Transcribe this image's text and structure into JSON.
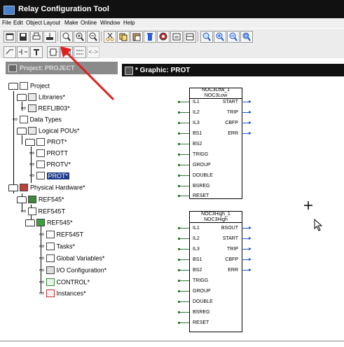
{
  "window": {
    "title": "Relay Configuration Tool"
  },
  "menu": [
    "File",
    "Edit",
    "Object",
    "Layout",
    "Make",
    "Online",
    "Window",
    "Help"
  ],
  "project_panel": {
    "title": "Project: PROJECT"
  },
  "tree": [
    {
      "label": "Project"
    },
    {
      "label": "Libraries*"
    },
    {
      "label": "REFLIB03*"
    },
    {
      "label": "Data Types"
    },
    {
      "label": "Logical POUs*"
    },
    {
      "label": "PROT*"
    },
    {
      "label": "PROTT"
    },
    {
      "label": "PROTV*"
    },
    {
      "label": "PROT*"
    },
    {
      "label": "Physical Hardware*"
    },
    {
      "label": "REF545*"
    },
    {
      "label": "REF545T"
    },
    {
      "label": "REF545*"
    },
    {
      "label": "REF545T"
    },
    {
      "label": "Tasks*"
    },
    {
      "label": "Global Variables*"
    },
    {
      "label": "I/O Configuration*"
    },
    {
      "label": "CONTROL*"
    },
    {
      "label": "Instances*"
    }
  ],
  "graphic": {
    "title": "* Graphic: PROT"
  },
  "blocks": [
    {
      "instance": "NOC3Low_1",
      "type": "NOC3Low",
      "inputs": [
        "IL1",
        "IL2",
        "IL3",
        "BS1",
        "BS2",
        "TRIGG",
        "GROUP",
        "DOUBLE",
        "BSREG",
        "RESET"
      ],
      "outputs": [
        "START",
        "TRIP",
        "CBFP",
        "ERR"
      ]
    },
    {
      "instance": "NOC3High_1",
      "type": "NOC3High",
      "inputs": [
        "IL1",
        "IL2",
        "IL3",
        "BS1",
        "BS2",
        "TRIGG",
        "GROUP",
        "DOUBLE",
        "BSREG",
        "RESET"
      ],
      "outputs": [
        "BSOUT",
        "START",
        "TRIP",
        "CBFP",
        "ERR"
      ]
    }
  ],
  "colors": {
    "selection": "#1d3a8a",
    "input_wire": "#2e7d32",
    "output_wire": "#1c58c7",
    "annotation_arrow": "#e02020"
  }
}
